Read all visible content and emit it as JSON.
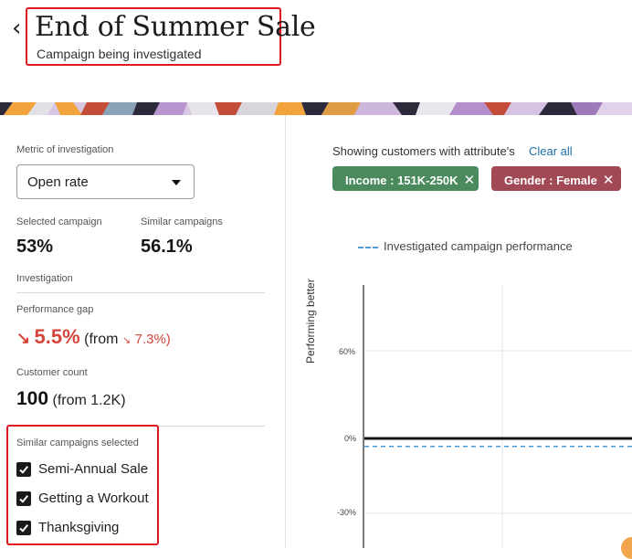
{
  "header": {
    "back_glyph": "‹",
    "title": "End of Summer Sale",
    "subtitle": "Campaign being investigated"
  },
  "left_panel": {
    "metric_label": "Metric of investigation",
    "metric_value": "Open rate",
    "selected_campaign_label": "Selected campaign",
    "selected_campaign_value": "53%",
    "similar_campaigns_label": "Similar campaigns",
    "similar_campaigns_value": "56.1%",
    "investigation_label": "Investigation",
    "performance_gap_label": "Performance gap",
    "performance_gap_arrow": "↘",
    "performance_gap_value": "5.5%",
    "performance_gap_from_prefix": "(from",
    "performance_gap_from_value": "7.3%)",
    "customer_count_label": "Customer count",
    "customer_count_value": "100",
    "customer_count_from": "(from 1.2K)",
    "similar_selected_label": "Similar campaigns selected",
    "similar_selected": [
      {
        "label": "Semi-Annual Sale",
        "checked": true
      },
      {
        "label": "Getting a Workout",
        "checked": true
      },
      {
        "label": "Thanksgiving",
        "checked": true
      }
    ]
  },
  "filters": {
    "showing_text": "Showing customers with attribute's",
    "clear_all": "Clear all",
    "chips": [
      {
        "label": "Income : 151K-250K",
        "color": "#4a8a5c",
        "close_icon": "close-icon"
      },
      {
        "label": "Gender : Female",
        "color": "#a14a55",
        "close_icon": "close-icon"
      }
    ]
  },
  "chart_data": {
    "type": "line",
    "legend": [
      {
        "name": "Investigated campaign performance",
        "style": "dashed",
        "color": "#4d9bd3"
      }
    ],
    "ylabel": "Performing better",
    "y_ticks": [
      "60%",
      "0%",
      "-30%"
    ],
    "series": [
      {
        "name": "",
        "role": "baseline",
        "values": [
          0
        ],
        "color": "#111111"
      },
      {
        "name": "Investigated campaign performance",
        "values": [
          -5.5
        ],
        "color": "#4d9bd3",
        "style": "dashed"
      }
    ]
  },
  "colors": {
    "accent_red": "#d4463b",
    "highlight_border": "#e0181f",
    "link_blue": "#1e6fa8"
  }
}
